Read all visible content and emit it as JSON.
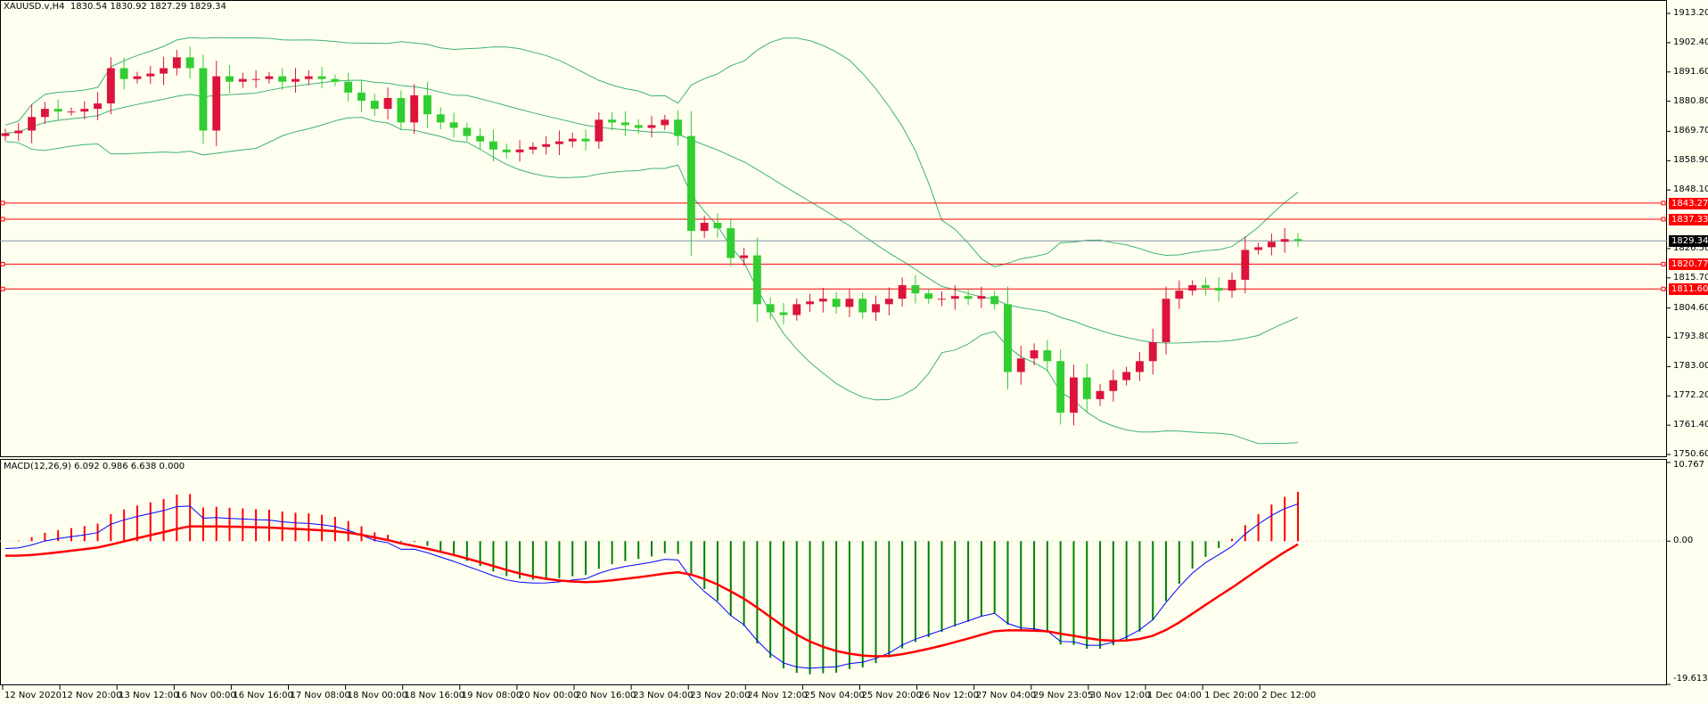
{
  "header": {
    "symbol": "XAUUSD.v,H4",
    "ohlc": "1830.54 1830.92 1827.29 1829.34"
  },
  "macd_header": "MACD(12,26,9) 6.092 0.986 6.638 0.000",
  "colors": {
    "background": "#fffff0",
    "up": "#dc143c",
    "down": "#32cd32",
    "bands": "#3cb371",
    "level": "#ff0000",
    "macd_line": "#0000ff",
    "signal_line": "#ff0000",
    "hist_pos": "#ff0000",
    "hist_neg": "#008000"
  },
  "price_axis": {
    "ticks": [
      "1913.20",
      "1902.40",
      "1891.60",
      "1880.80",
      "1869.70",
      "1858.90",
      "1848.10",
      "1826.50",
      "1815.70",
      "1804.60",
      "1793.80",
      "1783.00",
      "1772.20",
      "1761.40",
      "1750.60"
    ]
  },
  "macd_axis": {
    "ticks": [
      "10.767",
      "0.00",
      "-19.613"
    ]
  },
  "levels": [
    {
      "label": "1843.27",
      "value": 1843.27
    },
    {
      "label": "1837.33",
      "value": 1837.33
    },
    {
      "label": "1820.77",
      "value": 1820.77
    },
    {
      "label": "1811.60",
      "value": 1811.6
    }
  ],
  "current_price": {
    "label": "1829.34",
    "value": 1829.34
  },
  "time_axis": [
    "12 Nov 2020",
    "12 Nov 20:00",
    "13 Nov 12:00",
    "16 Nov 00:00",
    "16 Nov 16:00",
    "17 Nov 08:00",
    "18 Nov 00:00",
    "18 Nov 16:00",
    "19 Nov 08:00",
    "20 Nov 00:00",
    "20 Nov 16:00",
    "23 Nov 04:00",
    "23 Nov 20:00",
    "24 Nov 12:00",
    "25 Nov 04:00",
    "25 Nov 20:00",
    "26 Nov 12:00",
    "27 Nov 04:00",
    "29 Nov 23:05",
    "30 Nov 12:00",
    "1 Dec 04:00",
    "1 Dec 20:00",
    "2 Dec 12:00"
  ],
  "chart_data": {
    "type": "candlestick",
    "title": "XAUUSD.v,H4",
    "ylim": [
      1750.6,
      1913.2
    ],
    "indicators": [
      "Bollinger Bands (20)",
      "MACD(12,26,9)"
    ],
    "macd_ylim": [
      -19.613,
      10.767
    ],
    "closes": [
      1869,
      1870,
      1875,
      1878,
      1877,
      1877,
      1878,
      1880,
      1893,
      1889,
      1890,
      1891,
      1893,
      1897,
      1893,
      1870,
      1890,
      1888,
      1889,
      1889,
      1890,
      1888,
      1889,
      1890,
      1889,
      1888,
      1884,
      1881,
      1878,
      1882,
      1873,
      1883,
      1876,
      1873,
      1871,
      1868,
      1866,
      1863,
      1862,
      1863,
      1864,
      1865,
      1866,
      1867,
      1866,
      1874,
      1873,
      1872,
      1871,
      1872,
      1874,
      1868,
      1833,
      1836,
      1834,
      1823,
      1824,
      1806,
      1803,
      1802,
      1806,
      1807,
      1808,
      1805,
      1808,
      1803,
      1806,
      1808,
      1813,
      1810,
      1808,
      1808,
      1809,
      1808,
      1809,
      1806,
      1781,
      1786,
      1789,
      1785,
      1766,
      1779,
      1771,
      1774,
      1778,
      1781,
      1785,
      1792,
      1808,
      1811,
      1813,
      1812,
      1811,
      1815,
      1826,
      1827,
      1829,
      1830,
      1829.34
    ]
  }
}
